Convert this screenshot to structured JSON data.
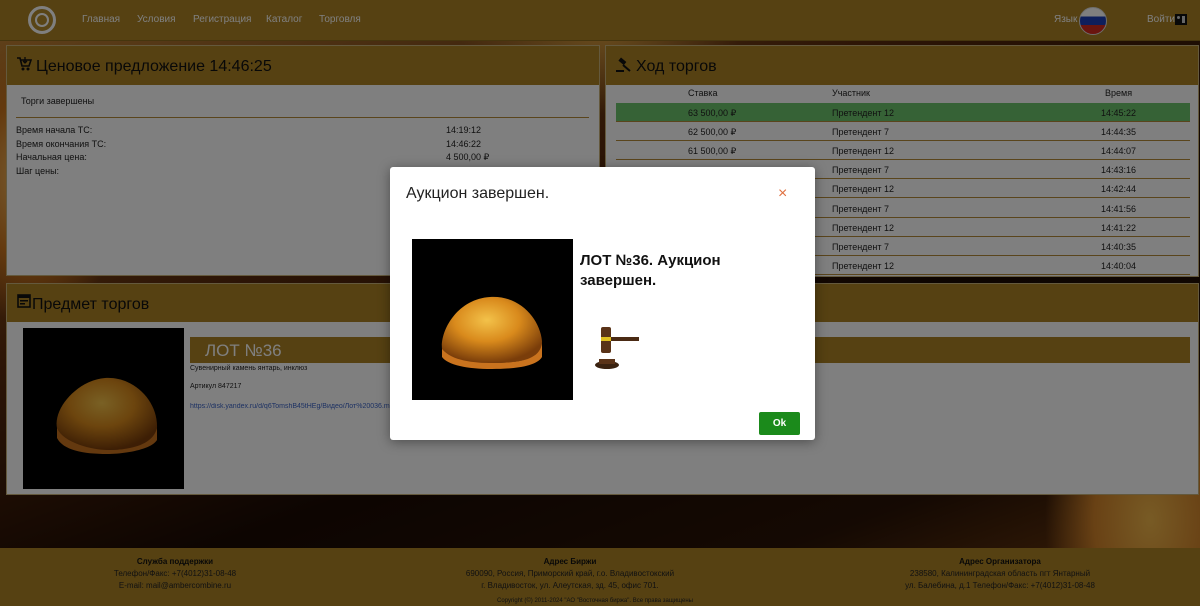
{
  "nav": {
    "items": [
      "Главная",
      "Условия",
      "Регистрация",
      "Каталог",
      "Торговля"
    ],
    "language_label": "Язык",
    "login_label": "Войти"
  },
  "bid_panel": {
    "title": "Ценовое предложение 14:46:25",
    "status": "Торги завершены",
    "fields": [
      {
        "label": "Время начала ТС:",
        "value": "14:19:12"
      },
      {
        "label": "Время окончания ТС:",
        "value": "14:46:22"
      },
      {
        "label": "Начальная цена:",
        "value": "4 500,00 ₽"
      },
      {
        "label": "Шаг цены:",
        "value": ""
      }
    ]
  },
  "progress_panel": {
    "title": "Ход торгов",
    "columns": [
      "Ставка",
      "Участник",
      "Время"
    ],
    "rows": [
      {
        "bid": "63 500,00 ₽",
        "participant": "Претендент 12",
        "time": "14:45:22",
        "highlight": true
      },
      {
        "bid": "62 500,00 ₽",
        "participant": "Претендент 7",
        "time": "14:44:35"
      },
      {
        "bid": "61 500,00 ₽",
        "participant": "Претендент 12",
        "time": "14:44:07"
      },
      {
        "bid": "",
        "participant": "Претендент 7",
        "time": "14:43:16"
      },
      {
        "bid": "",
        "participant": "Претендент 12",
        "time": "14:42:44"
      },
      {
        "bid": "",
        "participant": "Претендент 7",
        "time": "14:41:56"
      },
      {
        "bid": "",
        "participant": "Претендент 12",
        "time": "14:41:22"
      },
      {
        "bid": "",
        "participant": "Претендент 7",
        "time": "14:40:35"
      },
      {
        "bid": "",
        "participant": "Претендент 12",
        "time": "14:40:04"
      }
    ]
  },
  "subject_panel": {
    "title": "Предмет торгов",
    "lot_title": "ЛОТ №36",
    "description": "Сувенирный камень янтарь, инклюз",
    "article": "Артикул 847217",
    "link": "https://disk.yandex.ru/d/q6TomshB45tHEg/Видео/Лот%20036.m"
  },
  "footer": {
    "support_title": "Служба поддержки",
    "support_phone": "Телефон/Факс: +7(4012)31-08-48",
    "support_email": "E-mail: mail@ambercombine.ru",
    "exchange_title": "Адрес Биржи",
    "exchange_line1": "690090, Россия, Приморский край, г.о. Владивостокский",
    "exchange_line2": "г. Владивосток, ул. Алеутская, зд. 45, офис 701.",
    "organizer_title": "Адрес Организатора",
    "organizer_line1": "238580, Калининградская область пгт Янтарный",
    "organizer_line2": "ул. Балебина, д.1 Телефон/Факс: +7(4012)31-08-48",
    "copyright": "Copyright (©) 2011-2024 \"АО \"Восточная биржа\". Все права защищены"
  },
  "modal": {
    "title": "Аукцион завершен.",
    "close_symbol": "×",
    "heading": "ЛОТ №36. Аукцион завершен.",
    "ok_label": "Ok"
  },
  "colors": {
    "header_bar": "#ac8325",
    "highlight_row": "#6cc46c",
    "ok_button": "#1b8a1b",
    "link": "#3a63c6"
  }
}
